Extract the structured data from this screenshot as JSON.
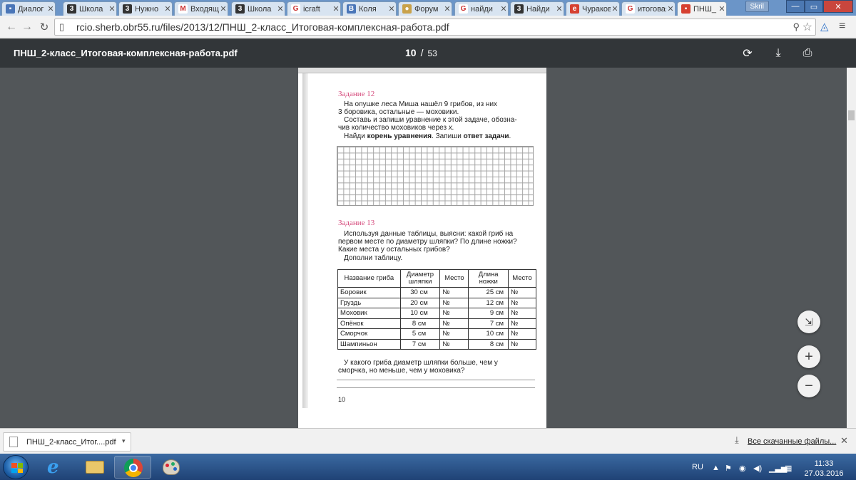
{
  "browser": {
    "tabs": [
      {
        "label": "Диалог",
        "favicon_color": "#4a76b8",
        "favicon_glyph": "▪"
      },
      {
        "label": "Школа",
        "favicon_color": "#333333",
        "favicon_glyph": "3"
      },
      {
        "label": "Нужно",
        "favicon_color": "#333333",
        "favicon_glyph": "3"
      },
      {
        "label": "Входящие",
        "favicon_color": "#ffffff",
        "favicon_glyph": "M"
      },
      {
        "label": "Школа",
        "favicon_color": "#333333",
        "favicon_glyph": "3"
      },
      {
        "label": "icraft",
        "favicon_color": "#ffffff",
        "favicon_glyph": "G"
      },
      {
        "label": "Коля",
        "favicon_color": "#4a76b8",
        "favicon_glyph": "B"
      },
      {
        "label": "Форум",
        "favicon_color": "#c9a24a",
        "favicon_glyph": "●"
      },
      {
        "label": "найди",
        "favicon_color": "#ffffff",
        "favicon_glyph": "G"
      },
      {
        "label": "Найди",
        "favicon_color": "#333333",
        "favicon_glyph": "3"
      },
      {
        "label": "Чураков",
        "favicon_color": "#d64030",
        "favicon_glyph": "e"
      },
      {
        "label": "итоговая",
        "favicon_color": "#ffffff",
        "favicon_glyph": "G"
      },
      {
        "label": "ПНШ_",
        "favicon_color": "#d64030",
        "favicon_glyph": "▪",
        "active": true
      }
    ],
    "user_badge": "Skril",
    "url": "rcio.sherb.obr55.ru/files/2013/12/ПНШ_2-класс_Итоговая-комплексная-работа.pdf"
  },
  "pdf": {
    "title": "ПНШ_2-класс_Итоговая-комплексная-работа.pdf",
    "current_page": "10",
    "separator": "/",
    "total_pages": "53"
  },
  "page": {
    "task12_heading": "Задание  12",
    "task12_lines": [
      "На  опушке  леса  Миша  нашёл  9  грибов,  из  них",
      "3 боровика, остальные — моховики.",
      "Составь  и  запиши  уравнение  к  этой  задаче,  обозна-",
      "чив количество моховиков через"
    ],
    "task12_var": "x.",
    "task12_find_pre": "Найди ",
    "task12_find_bold1": "корень уравнения",
    "task12_find_mid": ". Запиши ",
    "task12_find_bold2": "ответ задачи",
    "task12_find_post": ".",
    "task13_heading": "Задание  13",
    "task13_lines": [
      "Используя  данные  таблицы,  выясни:  какой  гриб  на",
      "первом  месте  по  диаметру  шляпки?  По  длине  ножки?",
      "Какие места у остальных грибов?",
      "Дополни таблицу."
    ],
    "table": {
      "headers": [
        "Название гриба",
        "Диаметр шляпки",
        "Место",
        "Длина ножки",
        "Место"
      ],
      "rows": [
        [
          "Боровик",
          "30 см",
          "№",
          "25 см",
          "№"
        ],
        [
          "Груздь",
          "20 см",
          "№",
          "12 см",
          "№"
        ],
        [
          "Моховик",
          "10 см",
          "№",
          "9 см",
          "№"
        ],
        [
          "Опёнок",
          "8 см",
          "№",
          "7 см",
          "№"
        ],
        [
          "Сморчок",
          "5 см",
          "№",
          "10 см",
          "№"
        ],
        [
          "Шампиньон",
          "7 см",
          "№",
          "8 см",
          "№"
        ]
      ]
    },
    "question_lines": [
      "У  какого  гриба  диаметр  шляпки  больше,  чем  у",
      "сморчка, но меньше, чем у моховика?"
    ],
    "page_number": "10"
  },
  "downloads": {
    "item_name": "ПНШ_2-класс_Итог....pdf",
    "all_downloads": "Все скачанные файлы..."
  },
  "taskbar": {
    "lang": "RU",
    "time": "11:33",
    "date": "27.03.2016"
  }
}
